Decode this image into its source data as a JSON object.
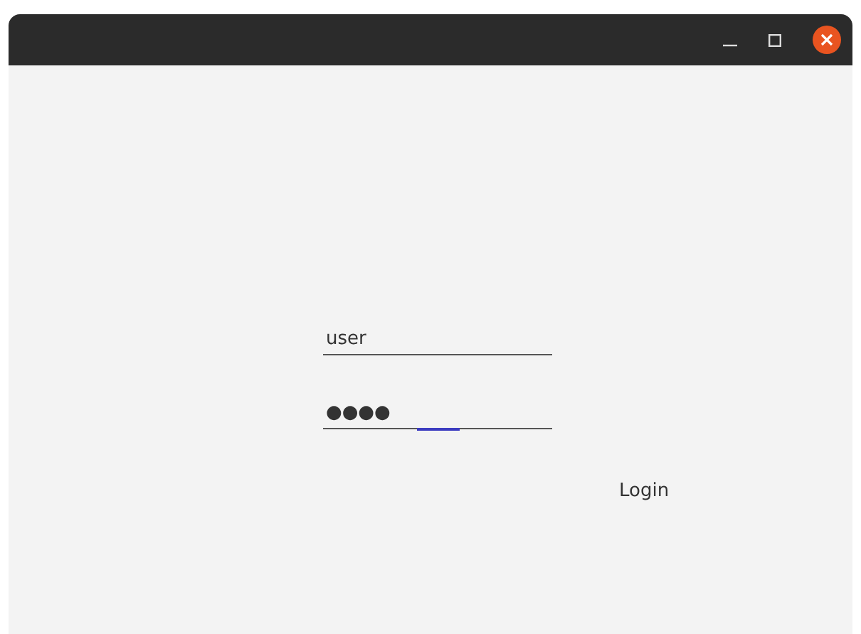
{
  "username": {
    "value": "user",
    "focused": false
  },
  "password": {
    "value": "●●●●",
    "focused": true
  },
  "login_button": {
    "label": "Login"
  }
}
